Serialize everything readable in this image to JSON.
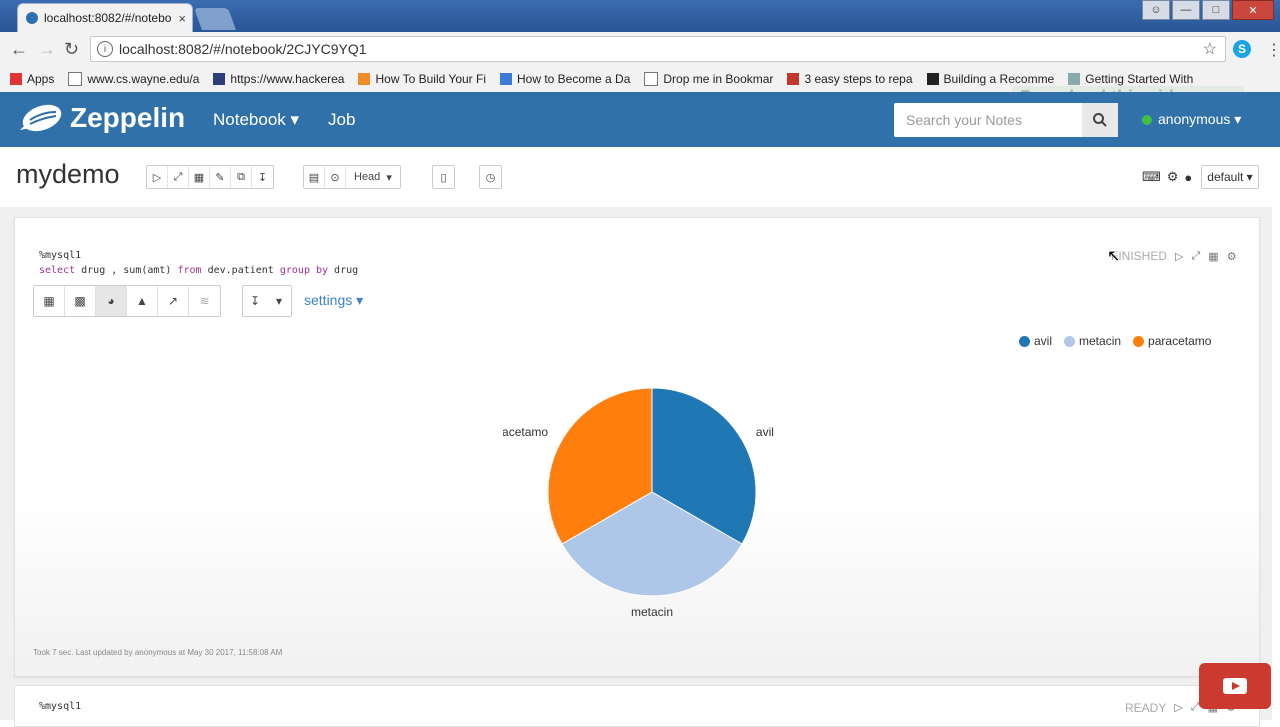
{
  "browser": {
    "tab_title": "localhost:8082/#/notebo",
    "tab_close": "×",
    "url": "localhost:8082/#/notebook/2CJYC9YQ1",
    "bookmarks": [
      {
        "label": "Apps",
        "icon": "apps-icon"
      },
      {
        "label": "www.cs.wayne.edu/a",
        "icon": "page-icon"
      },
      {
        "label": "https://www.hackerea",
        "icon": "hackerearth-icon"
      },
      {
        "label": "How To Build Your Fi",
        "icon": "a-icon"
      },
      {
        "label": "How to Become a Da",
        "icon": "globe-icon"
      },
      {
        "label": "Drop me in Bookmar",
        "icon": "page-icon"
      },
      {
        "label": "3 easy steps to repa",
        "icon": "bank-icon"
      },
      {
        "label": "Building a Recomme",
        "icon": "amazon-icon"
      },
      {
        "label": "Getting Started With",
        "icon": "puzzle-icon"
      }
    ],
    "download_overlay": "Download this video"
  },
  "header": {
    "brand": "Zeppelin",
    "nav_notebook": "Notebook ▾",
    "nav_job": "Job",
    "search_placeholder": "Search your Notes",
    "user": "anonymous ▾"
  },
  "notebook": {
    "title": "mydemo",
    "head_label": "Head",
    "default_label": "default ▾"
  },
  "paragraph1": {
    "code_line1": "%mysql1",
    "code_line2_parts": [
      "select",
      " drug , sum(amt) ",
      "from",
      " dev.patient ",
      "group by",
      " drug"
    ],
    "status": "FINISHED",
    "settings_label": "settings ▾",
    "footer": "Took 7 sec. Last updated by anonymous at May 30 2017, 11:58:08 AM"
  },
  "paragraph2": {
    "code_line1": "%mysql1",
    "status": "READY"
  },
  "colors": {
    "avil": "#1f77b4",
    "metacin": "#aec7e8",
    "paracetamo": "#ff7f0e",
    "header": "#3071a9"
  },
  "chart_data": {
    "type": "pie",
    "categories": [
      "avil",
      "metacin",
      "paracetamo"
    ],
    "values": [
      1,
      1,
      1
    ],
    "legend": [
      "avil",
      "metacin",
      "paracetamo"
    ],
    "legend_position": "top-right"
  }
}
